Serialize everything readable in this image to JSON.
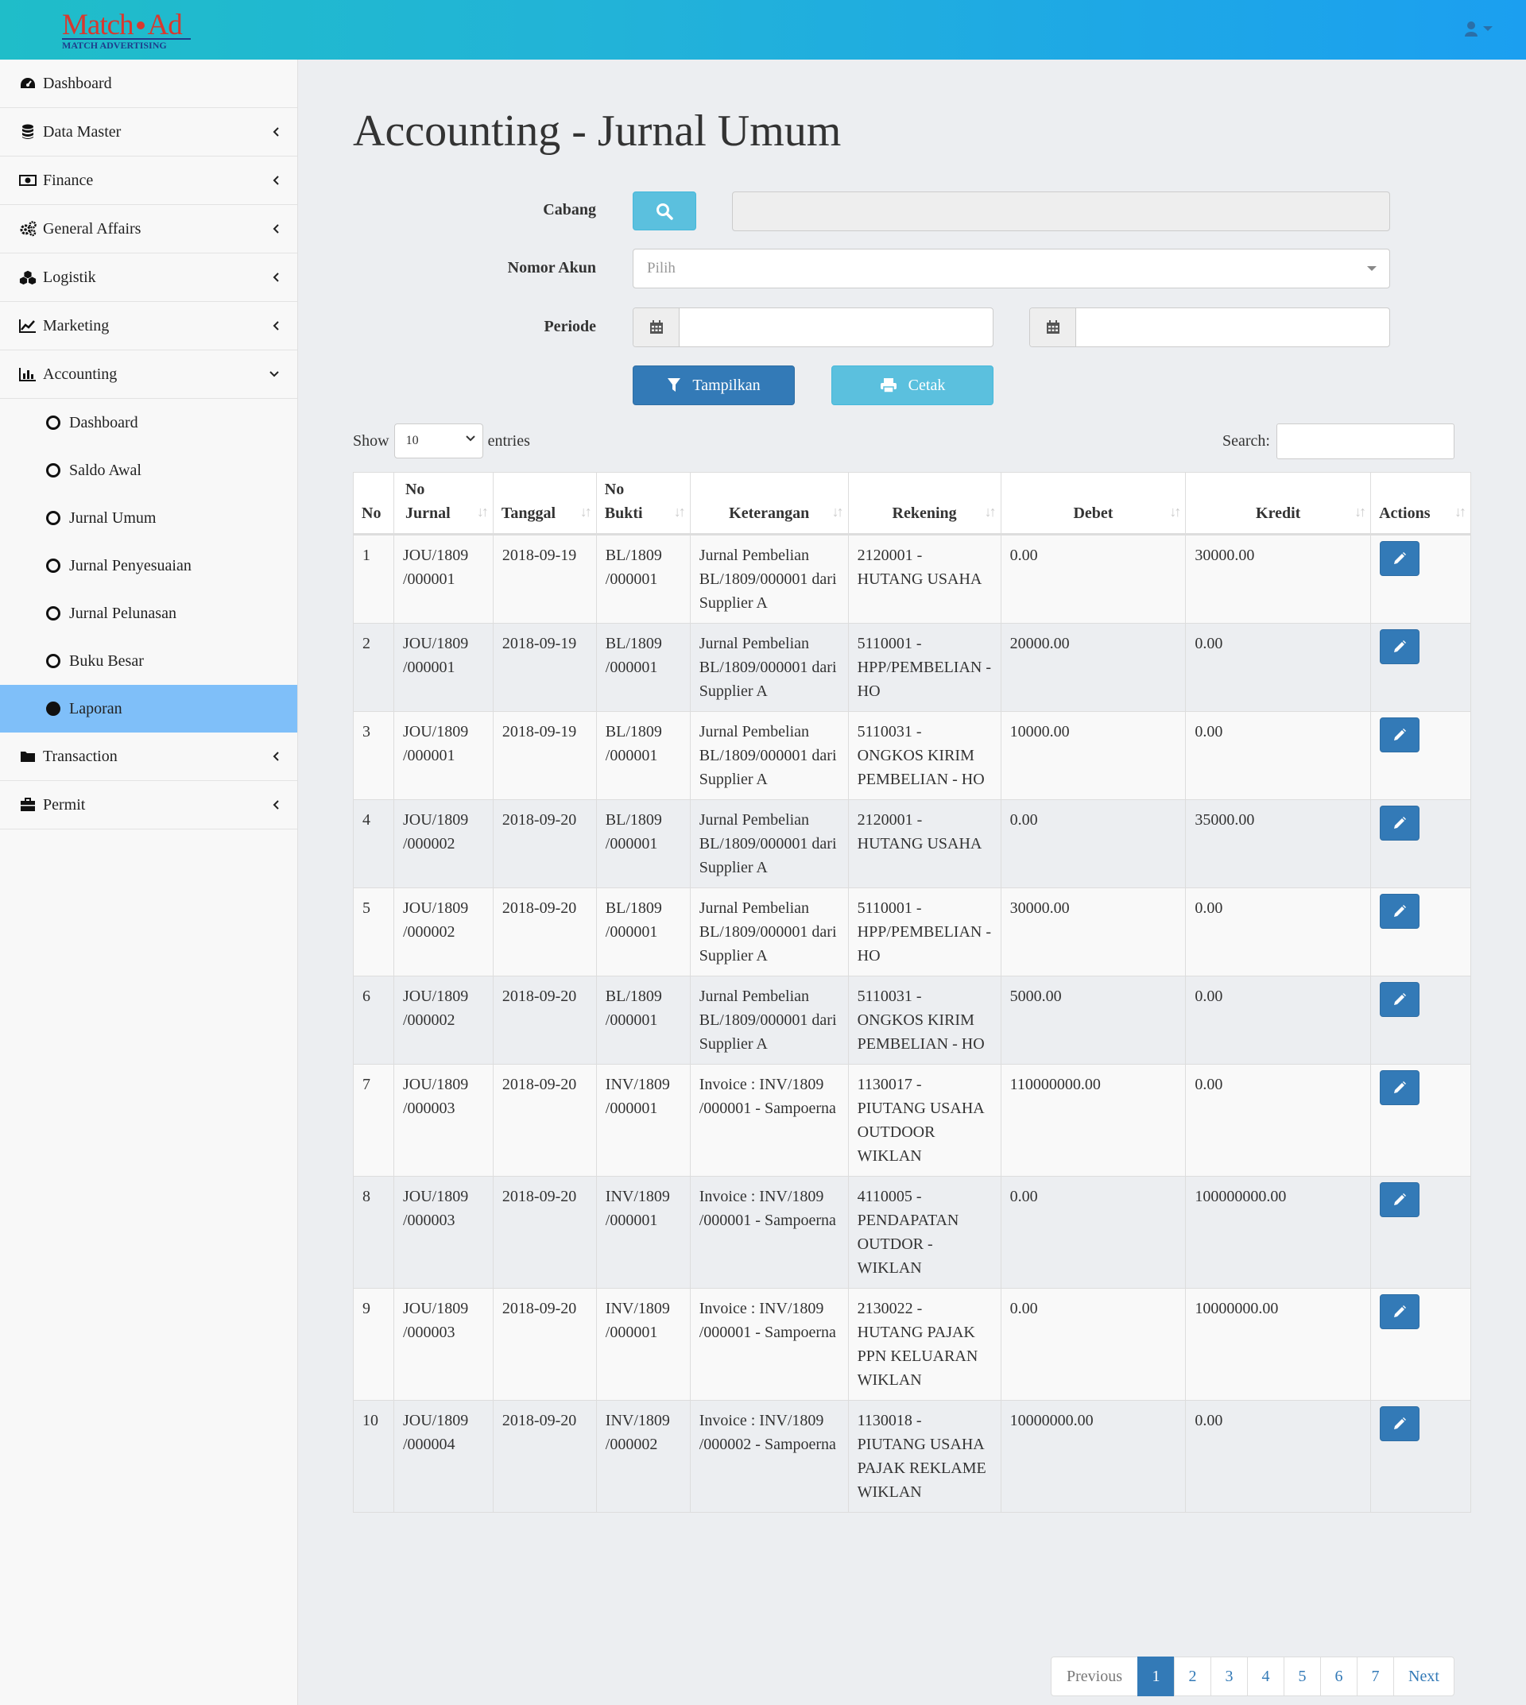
{
  "brand": {
    "name_part1": "Match",
    "name_part2": "Ad",
    "tagline": "MATCH ADVERTISING"
  },
  "sidebar": {
    "items": [
      {
        "label": "Dashboard",
        "icon": "dashboard-icon"
      },
      {
        "label": "Data Master",
        "icon": "database-icon"
      },
      {
        "label": "Finance",
        "icon": "money-icon"
      },
      {
        "label": "General Affairs",
        "icon": "cogs-icon"
      },
      {
        "label": "Logistik",
        "icon": "cubes-icon"
      },
      {
        "label": "Marketing",
        "icon": "line-chart-icon"
      },
      {
        "label": "Accounting",
        "icon": "bar-chart-icon"
      },
      {
        "label": "Transaction",
        "icon": "folder-icon"
      },
      {
        "label": "Permit",
        "icon": "briefcase-icon"
      }
    ],
    "accounting_sub": [
      "Dashboard",
      "Saldo Awal",
      "Jurnal Umum",
      "Jurnal Penyesuaian",
      "Jurnal Pelunasan",
      "Buku Besar",
      "Laporan"
    ]
  },
  "page": {
    "title": "Accounting - Jurnal Umum"
  },
  "form": {
    "cabang_label": "Cabang",
    "akun_label": "Nomor Akun",
    "akun_placeholder": "Pilih",
    "periode_label": "Periode",
    "tampilkan_label": "Tampilkan",
    "cetak_label": "Cetak"
  },
  "table_controls": {
    "show_label": "Show",
    "entries_value": "10",
    "entries_label": "entries",
    "search_label": "Search:"
  },
  "table": {
    "headers": [
      "No",
      "No Jurnal",
      "Tanggal",
      "No Bukti",
      "Keterangan",
      "Rekening",
      "Debet",
      "Kredit",
      "Actions"
    ],
    "rows": [
      {
        "no": "1",
        "jurnal": "JOU/1809 /000001",
        "tanggal": "2018-09-19",
        "bukti": "BL/1809 /000001",
        "keterangan": "Jurnal Pembelian BL/1809/000001 dari Supplier A",
        "rekening": "2120001 - HUTANG USAHA",
        "debet": "0.00",
        "kredit": "30000.00"
      },
      {
        "no": "2",
        "jurnal": "JOU/1809 /000001",
        "tanggal": "2018-09-19",
        "bukti": "BL/1809 /000001",
        "keterangan": "Jurnal Pembelian BL/1809/000001 dari Supplier A",
        "rekening": "5110001 - HPP/PEMBELIAN - HO",
        "debet": "20000.00",
        "kredit": "0.00"
      },
      {
        "no": "3",
        "jurnal": "JOU/1809 /000001",
        "tanggal": "2018-09-19",
        "bukti": "BL/1809 /000001",
        "keterangan": "Jurnal Pembelian BL/1809/000001 dari Supplier A",
        "rekening": "5110031 - ONGKOS KIRIM PEMBELIAN - HO",
        "debet": "10000.00",
        "kredit": "0.00"
      },
      {
        "no": "4",
        "jurnal": "JOU/1809 /000002",
        "tanggal": "2018-09-20",
        "bukti": "BL/1809 /000001",
        "keterangan": "Jurnal Pembelian BL/1809/000001 dari Supplier A",
        "rekening": "2120001 - HUTANG USAHA",
        "debet": "0.00",
        "kredit": "35000.00"
      },
      {
        "no": "5",
        "jurnal": "JOU/1809 /000002",
        "tanggal": "2018-09-20",
        "bukti": "BL/1809 /000001",
        "keterangan": "Jurnal Pembelian BL/1809/000001 dari Supplier A",
        "rekening": "5110001 - HPP/PEMBELIAN - HO",
        "debet": "30000.00",
        "kredit": "0.00"
      },
      {
        "no": "6",
        "jurnal": "JOU/1809 /000002",
        "tanggal": "2018-09-20",
        "bukti": "BL/1809 /000001",
        "keterangan": "Jurnal Pembelian BL/1809/000001 dari Supplier A",
        "rekening": "5110031 - ONGKOS KIRIM PEMBELIAN - HO",
        "debet": "5000.00",
        "kredit": "0.00"
      },
      {
        "no": "7",
        "jurnal": "JOU/1809 /000003",
        "tanggal": "2018-09-20",
        "bukti": "INV/1809 /000001",
        "keterangan": "Invoice : INV/1809 /000001 - Sampoerna",
        "rekening": "1130017 - PIUTANG USAHA OUTDOOR WIKLAN",
        "debet": "110000000.00",
        "kredit": "0.00"
      },
      {
        "no": "8",
        "jurnal": "JOU/1809 /000003",
        "tanggal": "2018-09-20",
        "bukti": "INV/1809 /000001",
        "keterangan": "Invoice : INV/1809 /000001 - Sampoerna",
        "rekening": "4110005 - PENDAPATAN OUTDOR - WIKLAN",
        "debet": "0.00",
        "kredit": "100000000.00"
      },
      {
        "no": "9",
        "jurnal": "JOU/1809 /000003",
        "tanggal": "2018-09-20",
        "bukti": "INV/1809 /000001",
        "keterangan": "Invoice : INV/1809 /000001 - Sampoerna",
        "rekening": "2130022 - HUTANG PAJAK PPN KELUARAN WIKLAN",
        "debet": "0.00",
        "kredit": "10000000.00"
      },
      {
        "no": "10",
        "jurnal": "JOU/1809 /000004",
        "tanggal": "2018-09-20",
        "bukti": "INV/1809 /000002",
        "keterangan": "Invoice : INV/1809 /000002 - Sampoerna",
        "rekening": "1130018 - PIUTANG USAHA PAJAK REKLAME WIKLAN",
        "debet": "10000000.00",
        "kredit": "0.00"
      }
    ]
  },
  "pagination": {
    "previous": "Previous",
    "pages": [
      "1",
      "2",
      "3",
      "4",
      "5",
      "6",
      "7"
    ],
    "active": "1",
    "next": "Next"
  },
  "colors": {
    "primary": "#337ab7",
    "info": "#5bc0de",
    "sidebar_active": "#7fbff9"
  }
}
